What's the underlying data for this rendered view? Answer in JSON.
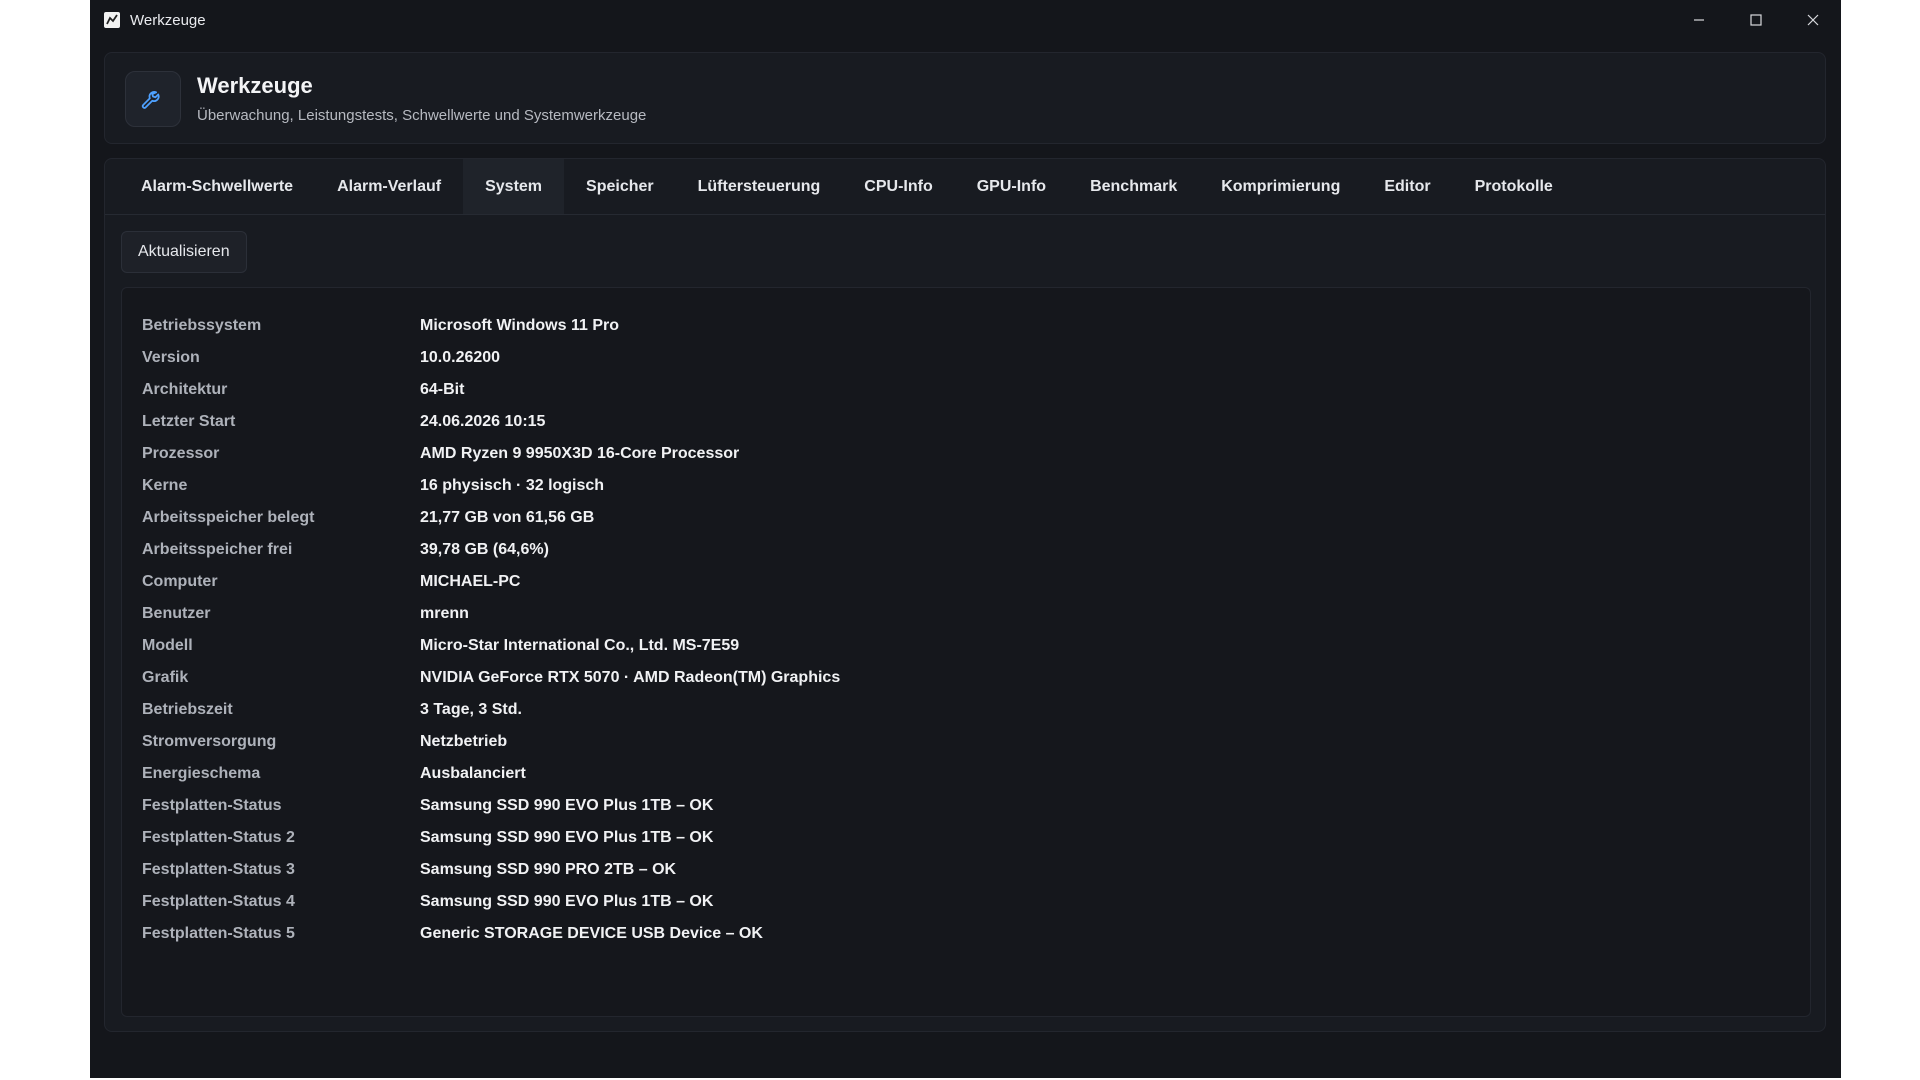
{
  "window": {
    "title": "Werkzeuge",
    "controls": {
      "minimize": "minimize",
      "maximize": "maximize",
      "close": "close"
    }
  },
  "header": {
    "icon": "wrench-icon",
    "title": "Werkzeuge",
    "subtitle": "Überwachung, Leistungstests, Schwellwerte und Systemwerkzeuge"
  },
  "tabs": [
    {
      "label": "Alarm-Schwellwerte"
    },
    {
      "label": "Alarm-Verlauf"
    },
    {
      "label": "System",
      "active": true
    },
    {
      "label": "Speicher"
    },
    {
      "label": "Lüftersteuerung"
    },
    {
      "label": "CPU-Info"
    },
    {
      "label": "GPU-Info"
    },
    {
      "label": "Benchmark"
    },
    {
      "label": "Komprimierung"
    },
    {
      "label": "Editor"
    },
    {
      "label": "Protokolle"
    }
  ],
  "toolbar": {
    "refresh_label": "Aktualisieren"
  },
  "system_info": [
    {
      "label": "Betriebssystem",
      "value": "Microsoft Windows 11 Pro"
    },
    {
      "label": "Version",
      "value": "10.0.26200"
    },
    {
      "label": "Architektur",
      "value": "64-Bit"
    },
    {
      "label": "Letzter Start",
      "value": "24.06.2026 10:15"
    },
    {
      "label": "Prozessor",
      "value": "AMD Ryzen 9 9950X3D 16-Core Processor"
    },
    {
      "label": "Kerne",
      "value": "16 physisch · 32 logisch"
    },
    {
      "label": "Arbeitsspeicher belegt",
      "value": "21,77 GB von 61,56 GB"
    },
    {
      "label": "Arbeitsspeicher frei",
      "value": "39,78 GB (64,6%)"
    },
    {
      "label": "Computer",
      "value": "MICHAEL-PC"
    },
    {
      "label": "Benutzer",
      "value": "mrenn"
    },
    {
      "label": "Modell",
      "value": "Micro-Star International Co., Ltd. MS-7E59"
    },
    {
      "label": "Grafik",
      "value": "NVIDIA GeForce RTX 5070 · AMD Radeon(TM) Graphics"
    },
    {
      "label": "Betriebszeit",
      "value": "3 Tage, 3 Std."
    },
    {
      "label": "Stromversorgung",
      "value": "Netzbetrieb"
    },
    {
      "label": "Energieschema",
      "value": "Ausbalanciert"
    },
    {
      "label": "Festplatten-Status",
      "value": "Samsung SSD 990 EVO Plus 1TB – OK"
    },
    {
      "label": "Festplatten-Status 2",
      "value": "Samsung SSD 990 EVO Plus 1TB – OK"
    },
    {
      "label": "Festplatten-Status 3",
      "value": "Samsung SSD 990 PRO 2TB – OK"
    },
    {
      "label": "Festplatten-Status 4",
      "value": "Samsung SSD 990 EVO Plus 1TB – OK"
    },
    {
      "label": "Festplatten-Status 5",
      "value": "Generic STORAGE DEVICE USB Device – OK"
    }
  ]
}
